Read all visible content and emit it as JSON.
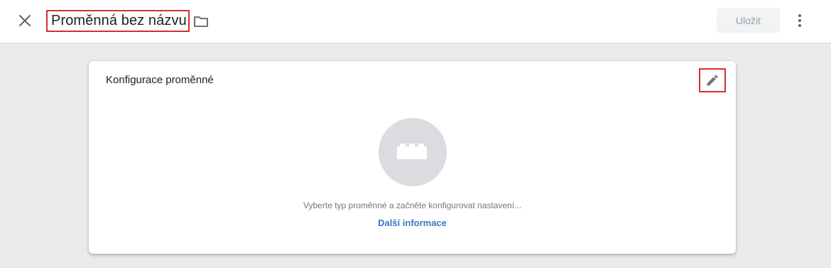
{
  "header": {
    "close_icon": "close-icon",
    "title": "Proměnná bez názvu",
    "folder_icon": "folder-icon",
    "save_label": "Uložit",
    "more_icon": "more-vert-icon"
  },
  "card": {
    "title": "Konfigurace proměnné",
    "edit_icon": "pencil-icon",
    "placeholder_icon": "brick-icon",
    "empty_text": "Vyberte typ proměnné a začněte konfigurovat nastavení...",
    "learn_more": "Další informace"
  },
  "colors": {
    "accent_link": "#3b78c3",
    "highlight_border": "#d32f2f",
    "background": "#ebebeb"
  }
}
